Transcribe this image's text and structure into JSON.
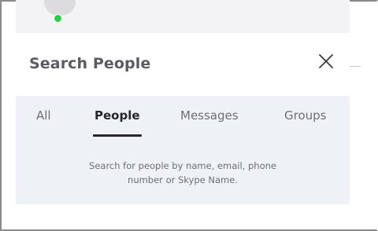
{
  "panel": {
    "title": "Search People",
    "close_icon": "close-icon"
  },
  "tabs": [
    {
      "label": "All",
      "active": false
    },
    {
      "label": "People",
      "active": true
    },
    {
      "label": "Messages",
      "active": false
    },
    {
      "label": "Groups",
      "active": false
    }
  ],
  "hint": {
    "line1": "Search for people by name, email, phone",
    "line2": "number or Skype Name."
  },
  "presence": {
    "status": "online",
    "color": "#2ecc40"
  }
}
